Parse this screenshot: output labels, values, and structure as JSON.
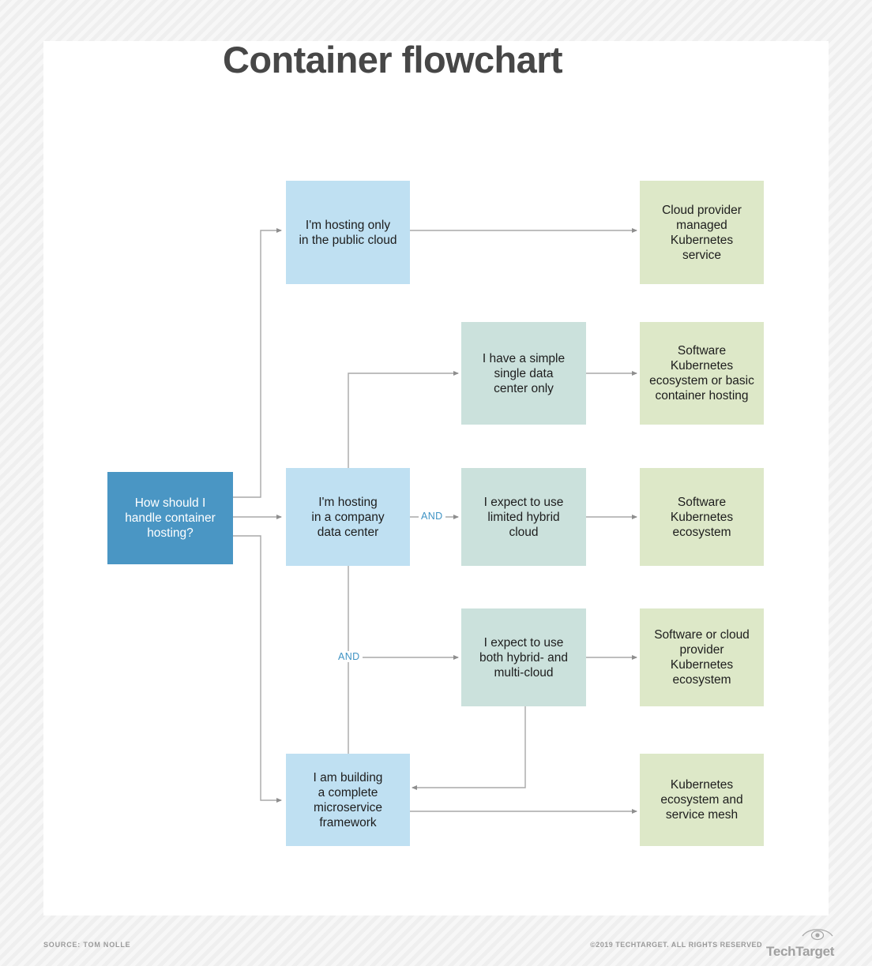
{
  "title": "Container flowchart",
  "colors": {
    "root": "#4a96c4",
    "blue": "#bfe0f2",
    "teal": "#cbe1dc",
    "green": "#dde8c8",
    "connector": "#9a9a9a",
    "and_label": "#3f93c4",
    "title": "#474747",
    "card": "#ffffff"
  },
  "chart_data": {
    "type": "diagram",
    "title": "Container flowchart",
    "nodes": [
      {
        "id": "root",
        "label": "How should I\nhandle container\nhosting?",
        "kind": "question",
        "color": "#4a96c4"
      },
      {
        "id": "public_cloud",
        "label": "I'm hosting only\nin the public cloud",
        "kind": "branch",
        "color": "#bfe0f2"
      },
      {
        "id": "data_center",
        "label": "I'm hosting\nin a company\ndata center",
        "kind": "branch",
        "color": "#bfe0f2"
      },
      {
        "id": "single_dc",
        "label": "I have a simple\nsingle data\ncenter only",
        "kind": "condition",
        "color": "#cbe1dc"
      },
      {
        "id": "limited_hybrid",
        "label": "I expect to use\nlimited hybrid\ncloud",
        "kind": "condition",
        "color": "#cbe1dc"
      },
      {
        "id": "multi_cloud",
        "label": "I expect to use\nboth hybrid- and\nmulti-cloud",
        "kind": "condition",
        "color": "#cbe1dc"
      },
      {
        "id": "microservice",
        "label": "I am building\na complete\nmicroservice\nframework",
        "kind": "branch",
        "color": "#bfe0f2"
      },
      {
        "id": "out_managed",
        "label": "Cloud provider\nmanaged\nKubernetes\nservice",
        "kind": "outcome",
        "color": "#dde8c8"
      },
      {
        "id": "out_basic",
        "label": "Software\nKubernetes\necosystem or basic\ncontainer hosting",
        "kind": "outcome",
        "color": "#dde8c8"
      },
      {
        "id": "out_software",
        "label": "Software\nKubernetes\necosystem",
        "kind": "outcome",
        "color": "#dde8c8"
      },
      {
        "id": "out_software_cloud",
        "label": "Software or cloud\nprovider\nKubernetes\necosystem",
        "kind": "outcome",
        "color": "#dde8c8"
      },
      {
        "id": "out_mesh",
        "label": "Kubernetes\necosystem and\nservice mesh",
        "kind": "outcome",
        "color": "#dde8c8"
      }
    ],
    "edges": [
      {
        "from": "root",
        "to": "public_cloud",
        "label": ""
      },
      {
        "from": "root",
        "to": "data_center",
        "label": ""
      },
      {
        "from": "root",
        "to": "microservice",
        "label": ""
      },
      {
        "from": "public_cloud",
        "to": "out_managed",
        "label": ""
      },
      {
        "from": "data_center",
        "to": "single_dc",
        "label": ""
      },
      {
        "from": "data_center",
        "to": "limited_hybrid",
        "label": "AND"
      },
      {
        "from": "data_center",
        "to": "multi_cloud",
        "label": "AND"
      },
      {
        "from": "data_center",
        "to": "microservice",
        "label": ""
      },
      {
        "from": "single_dc",
        "to": "out_basic",
        "label": ""
      },
      {
        "from": "limited_hybrid",
        "to": "out_software",
        "label": ""
      },
      {
        "from": "multi_cloud",
        "to": "out_software_cloud",
        "label": ""
      },
      {
        "from": "multi_cloud",
        "to": "microservice",
        "label": ""
      },
      {
        "from": "microservice",
        "to": "out_mesh",
        "label": ""
      }
    ],
    "edge_labels": [
      "AND",
      "AND"
    ]
  },
  "nodes": {
    "root": "How should I\nhandle container\nhosting?",
    "public_cloud": "I'm hosting only\nin the public cloud",
    "data_center": "I'm hosting\nin a company\ndata center",
    "single_dc": "I have a simple\nsingle data\ncenter only",
    "limited_hybrid": "I expect to use\nlimited hybrid\ncloud",
    "multi_cloud": "I expect to use\nboth hybrid- and\nmulti-cloud",
    "microservice": "I am building\na complete\nmicroservice\nframework",
    "out_managed": "Cloud provider\nmanaged\nKubernetes\nservice",
    "out_basic": "Software\nKubernetes\necosystem or basic\ncontainer hosting",
    "out_software": "Software\nKubernetes\necosystem",
    "out_software_cloud": "Software or cloud\nprovider\nKubernetes\necosystem",
    "out_mesh": "Kubernetes\necosystem and\nservice mesh"
  },
  "labels": {
    "and_1": "AND",
    "and_2": "AND"
  },
  "footer": {
    "source": "SOURCE: TOM NOLLE",
    "copyright": "©2019 TECHTARGET. ALL RIGHTS RESERVED",
    "logo_word": "TechTarget",
    "logo_icon": "eye-icon"
  }
}
